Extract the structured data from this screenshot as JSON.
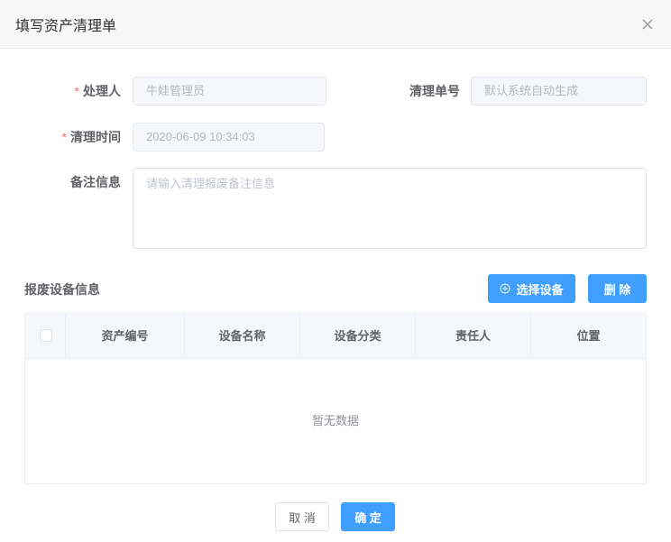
{
  "dialog": {
    "title": "填写资产清理单",
    "close_icon": "close-icon"
  },
  "form": {
    "handler": {
      "label": "处理人",
      "required_mark": "*",
      "value": "牛娃管理员"
    },
    "order_no": {
      "label": "清理单号",
      "placeholder": "默认系统自动生成"
    },
    "clear_time": {
      "label": "清理时间",
      "required_mark": "*",
      "value": "2020-06-09 10:34:03"
    },
    "remark": {
      "label": "备注信息",
      "placeholder": "请输入清理报废备注信息"
    }
  },
  "equipment": {
    "section_title": "报废设备信息",
    "select_button": "选择设备",
    "select_icon": "plus-circle-icon",
    "delete_button": "删 除",
    "columns": [
      "资产编号",
      "设备名称",
      "设备分类",
      "责任人",
      "位置"
    ],
    "empty_text": "暂无数据"
  },
  "footer": {
    "cancel_button": "取 消",
    "confirm_button": "确 定"
  },
  "colors": {
    "primary": "#409eff",
    "required": "#f56c6c",
    "header_bg": "#f7f7f7",
    "disabled_input_bg": "#f5f7fa"
  }
}
